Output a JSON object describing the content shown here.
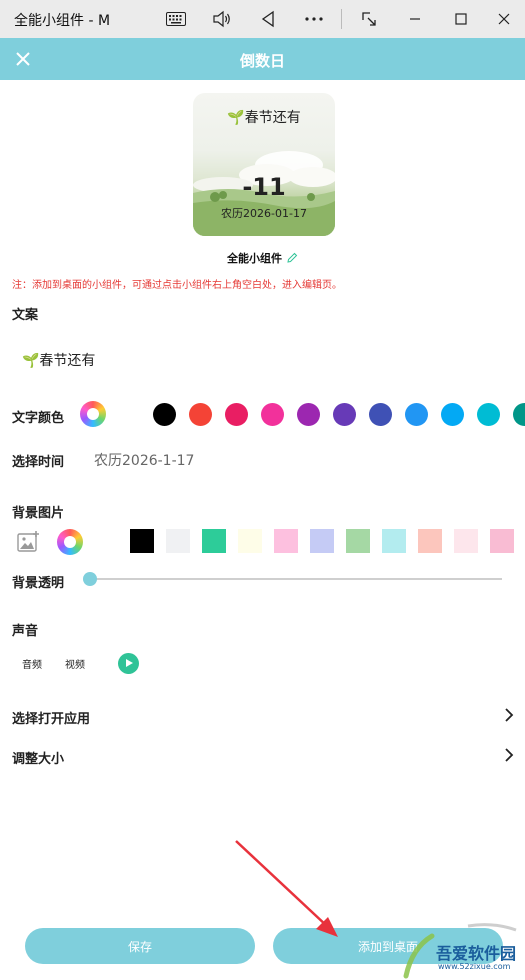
{
  "window": {
    "title": "全能小组件 - M",
    "icons": [
      "keyboard-icon",
      "volume-icon",
      "back-icon",
      "more-icon",
      "screenshot-icon",
      "minimize-icon",
      "maximize-icon",
      "close-icon"
    ]
  },
  "header": {
    "title": "倒数日",
    "close_icon": "close-icon",
    "accent_color": "#7fcfdc"
  },
  "preview": {
    "caption": "🌱春节还有",
    "number": "-11",
    "date": "农历2026-01-17"
  },
  "widget_name": "全能小组件",
  "notice": "注：添加到桌面的小组件，可通过点击小组件右上角空白处，进入编辑页。",
  "sections": {
    "text_label": "文案",
    "text_value": "🌱春节还有",
    "text_color_label": "文字颜色",
    "time_label": "选择时间",
    "time_value": "农历2026-1-17",
    "bg_image_label": "背景图片",
    "bg_opacity_label": "背景透明",
    "bg_opacity": 0,
    "sound_label": "声音",
    "sound_options": [
      "音频",
      "视频"
    ],
    "open_app_label": "选择打开应用",
    "resize_label": "调整大小"
  },
  "text_colors": [
    "#000000",
    "#f44336",
    "#e91e63",
    "#f2319b",
    "#9c27b0",
    "#673ab7",
    "#3f51b5",
    "#2196f3",
    "#03a9f4",
    "#00bcd4",
    "#009688"
  ],
  "bg_colors": [
    "#ffffff",
    "#000000",
    "#f0f1f3",
    "#2dcc99",
    "#fefde8",
    "#fdc0df",
    "#c5cbf5",
    "#a5d8a4",
    "#b3ecef",
    "#fcc6bd",
    "#fde6ec",
    "#f9bcd3"
  ],
  "buttons": {
    "save": "保存",
    "add_to_desktop": "添加到桌面"
  },
  "watermark": {
    "name": "吾爱软件园",
    "url": "www.52zixue.com"
  }
}
